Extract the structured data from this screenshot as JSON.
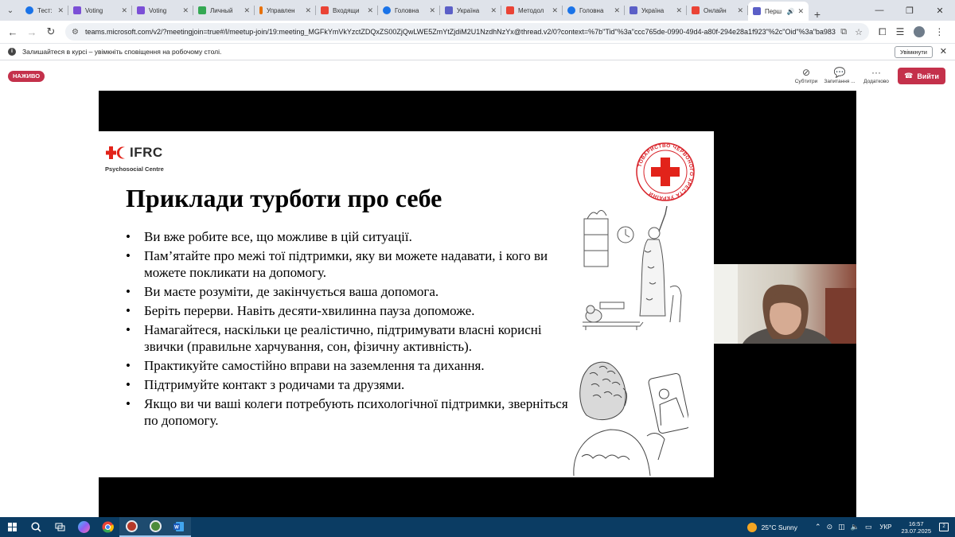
{
  "browser": {
    "tabs": [
      {
        "title": "Тест: Дра",
        "icon": "blue-circle-icon",
        "color": "#1a73e8"
      },
      {
        "title": "Voting",
        "icon": "bar-chart-icon",
        "color": "#7b4fd6"
      },
      {
        "title": "Voting",
        "icon": "bar-chart-icon",
        "color": "#7b4fd6"
      },
      {
        "title": "Личный",
        "icon": "drive-icon",
        "color": "#34a853"
      },
      {
        "title": "Управлен",
        "icon": "info-icon",
        "color": "#e8710a"
      },
      {
        "title": "Входящи",
        "icon": "gmail-icon",
        "color": "#ea4335"
      },
      {
        "title": "Головна",
        "icon": "blue-circle-icon",
        "color": "#1a73e8"
      },
      {
        "title": "Україна",
        "icon": "teams-icon",
        "color": "#5b5fc7"
      },
      {
        "title": "Методол",
        "icon": "gmail-icon",
        "color": "#ea4335"
      },
      {
        "title": "Головна",
        "icon": "blue-circle-icon",
        "color": "#1a73e8"
      },
      {
        "title": "Україна",
        "icon": "teams-icon",
        "color": "#5b5fc7"
      },
      {
        "title": "Онлайн",
        "icon": "gmail-icon",
        "color": "#ea4335"
      },
      {
        "title": "Перш",
        "icon": "teams-icon",
        "color": "#5b5fc7",
        "active": true
      }
    ],
    "url": "teams.microsoft.com/v2/?meetingjoin=true#/l/meetup-join/19:meeting_MGFkYmVkYzctZDQxZS00ZjQwLWE5ZmYtZjdiM2U1NzdhNzYx@thread.v2/0?context=%7b\"Tid\"%3a\"ccc765de-0990-49d4-a80f-294e28a1f923\"%2c\"Oid\"%3a\"ba9835a7-d1f..."
  },
  "infobar": {
    "text": "Залишайтеся в курсі – увімкніть сповіщення на робочому столі.",
    "button": "Увімкнути"
  },
  "meeting": {
    "live_label": "НАЖИВО",
    "tools": [
      {
        "label": "Субтитри",
        "icon": "captions-off-icon"
      },
      {
        "label": "Запитання ...",
        "icon": "qa-icon"
      },
      {
        "label": "Додатково",
        "icon": "more-icon"
      }
    ],
    "leave_label": "Вийти"
  },
  "slide": {
    "logo_text": "IFRC",
    "logo_sub": "Psychosocial Centre",
    "seal_text": "ТОВАРИСТВО ЧЕРВОНОГО ХРЕСТА УКРАЇНИ",
    "title": "Приклади турботи про себе",
    "bullets": [
      "Ви вже робите все, що можливе в цій ситуації.",
      "Пам’ятайте про межі тої підтримки, яку ви можете надавати, і кого ви можете покликати на допомогу.",
      "Ви маєте розуміти, де закінчується ваша допомога.",
      "Беріть перерви. Навіть десяти-хвилинна пауза допоможе.",
      "Намагайтеся, наскільки це реалістично, підтримувати власні корисні звички (правильне харчування, сон, фізичну активність).",
      "Практикуйте самостійно вправи на заземлення та дихання.",
      "Підтримуйте контакт з родичами та друзями.",
      "Якщо ви чи ваші колеги потребують психологічної підтримки, зверніться по допомогу."
    ]
  },
  "taskbar": {
    "weather": "25°C  Sunny",
    "lang": "УКР",
    "time": "16:57",
    "date": "23.07.2025",
    "notifications": "2"
  },
  "colors": {
    "teams_red": "#c4314b",
    "red_cross": "#e2231a",
    "taskbar": "#0b3c63"
  }
}
